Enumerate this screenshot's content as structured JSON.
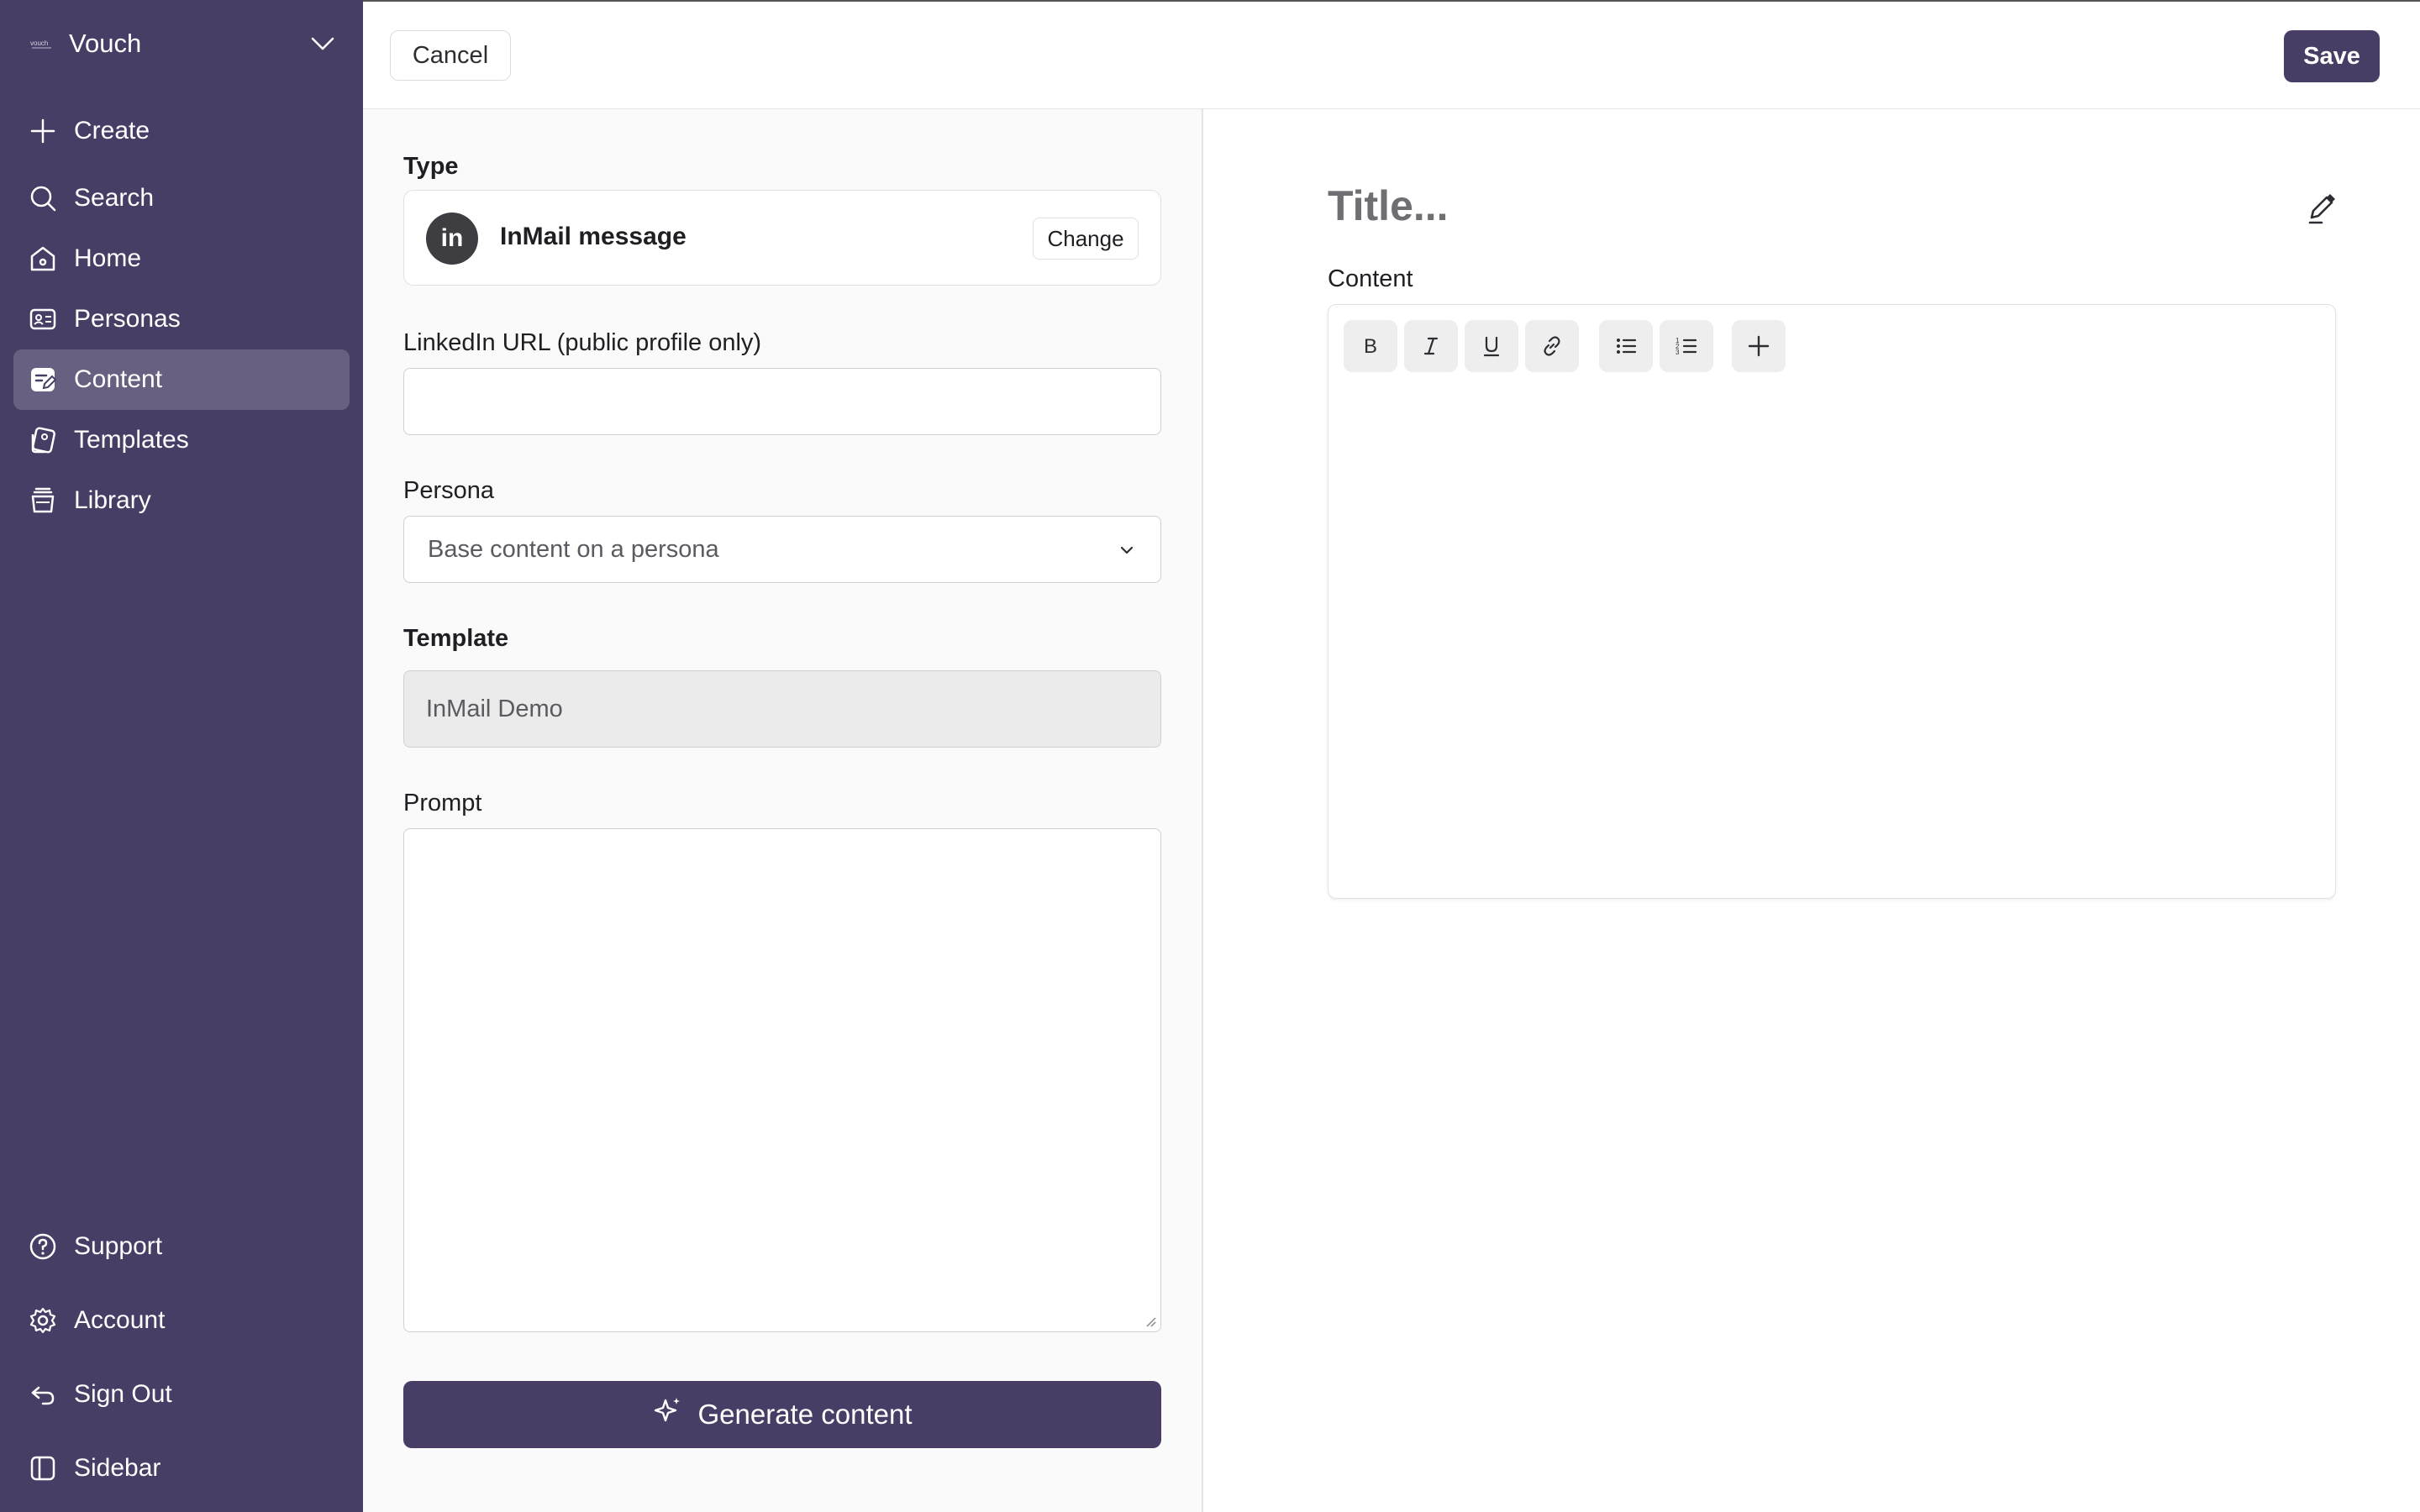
{
  "brand": {
    "name": "Vouch",
    "logo_text": "vouch"
  },
  "sidebar": {
    "items": [
      {
        "label": "Create",
        "icon": "plus-icon"
      },
      {
        "label": "Search",
        "icon": "search-icon"
      },
      {
        "label": "Home",
        "icon": "home-icon"
      },
      {
        "label": "Personas",
        "icon": "id-card-icon"
      },
      {
        "label": "Content",
        "icon": "edit-document-icon",
        "active": true
      },
      {
        "label": "Templates",
        "icon": "templates-icon"
      },
      {
        "label": "Library",
        "icon": "library-icon"
      }
    ],
    "bottom_items": [
      {
        "label": "Support",
        "icon": "help-circle-icon"
      },
      {
        "label": "Account",
        "icon": "gear-icon"
      },
      {
        "label": "Sign Out",
        "icon": "sign-out-icon"
      },
      {
        "label": "Sidebar",
        "icon": "sidebar-toggle-icon"
      }
    ]
  },
  "toolbar": {
    "cancel_label": "Cancel",
    "save_label": "Save"
  },
  "form": {
    "type_label": "Type",
    "type_value": "InMail message",
    "type_icon_text": "in",
    "change_label": "Change",
    "linkedin_label": "LinkedIn URL (public profile only)",
    "linkedin_value": "",
    "persona_label": "Persona",
    "persona_placeholder": "Base content on a persona",
    "template_label": "Template",
    "template_value": "InMail Demo",
    "prompt_label": "Prompt",
    "prompt_value": "",
    "generate_label": "Generate content"
  },
  "editor": {
    "title_placeholder": "Title...",
    "content_label": "Content",
    "toolbar": [
      "bold-icon",
      "italic-icon",
      "underline-icon",
      "link-icon",
      "bullet-list-icon",
      "numbered-list-icon",
      "plus-icon"
    ]
  },
  "colors": {
    "sidebar_bg": "#473d65",
    "primary": "#473d65",
    "panel_bg": "#fafafa"
  }
}
